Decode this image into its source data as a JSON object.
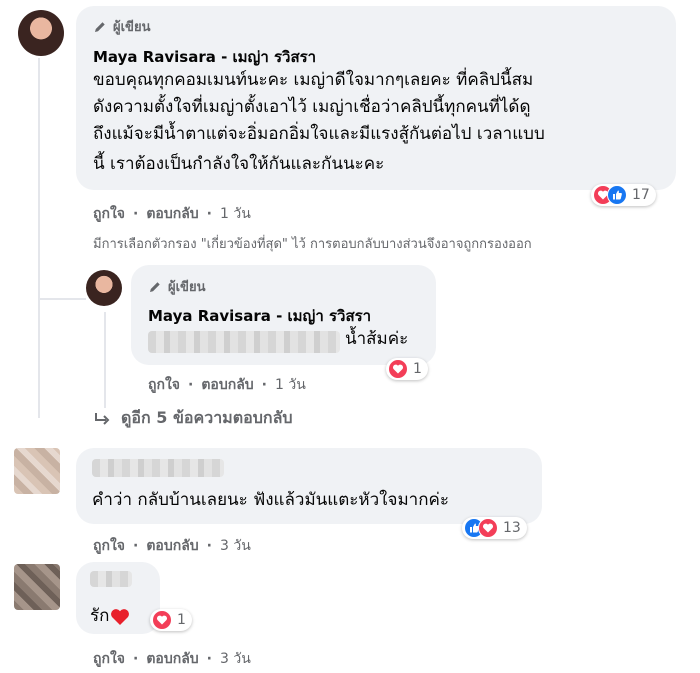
{
  "comment1": {
    "author_badge": "ผู้เขียน",
    "author_name": "Maya Ravisara - เมญ่า รวิสรา",
    "lines": [
      "ขอบคุณทุกคอมเมนท์นะคะ เมญ่าดีใจมากๆเลยคะ ที่คลิปนี้สม",
      "ดังความตั้งใจที่เมญ่าตั้งเอาไว้ เมญ่าเชื่อว่าคลิปนี้ทุกคนที่ได้ดู",
      "ถึงแม้จะมีน้ำตาแต่จะอิ่มอกอิ่มใจและมีแรงสู้กันต่อไป เวลาแบบ",
      "นี้ เราต้องเป็นกำลังใจให้กันและกันนะคะ"
    ],
    "reaction_count": "17",
    "like_label": "ถูกใจ",
    "reply_label": "ตอบกลับ",
    "time": "1 วัน"
  },
  "filter_note": "มีการเลือกตัวกรอง \"เกี่ยวข้องที่สุด\" ไว้ การตอบกลับบางส่วนจึงอาจถูกกรองออก",
  "reply1": {
    "author_badge": "ผู้เขียน",
    "author_name": "Maya Ravisara - เมญ่า รวิสรา",
    "text": "น้ำส้มค่ะ",
    "reaction_count": "1",
    "like_label": "ถูกใจ",
    "reply_label": "ตอบกลับ",
    "time": "1 วัน"
  },
  "more_replies": "ดูอีก 5 ข้อความตอบกลับ",
  "comment2": {
    "text": "คำว่า กลับบ้านเลยนะ ฟังแล้วมันแตะหัวใจมากค่ะ",
    "reaction_count": "13",
    "like_label": "ถูกใจ",
    "reply_label": "ตอบกลับ",
    "time": "3 วัน"
  },
  "comment3": {
    "text": "รัก",
    "reaction_count": "1",
    "like_label": "ถูกใจ",
    "reply_label": "ตอบกลับ",
    "time": "3 วัน"
  },
  "separator": "·",
  "icons": {
    "pencil": "pencil-icon",
    "heart": "heart-icon",
    "like": "thumbs-up-icon",
    "reply_arrow": "reply-arrow-icon"
  },
  "colors": {
    "love": "#f33e58",
    "like": "#1877f2",
    "bubble": "#f0f2f5",
    "meta": "#65676b"
  }
}
